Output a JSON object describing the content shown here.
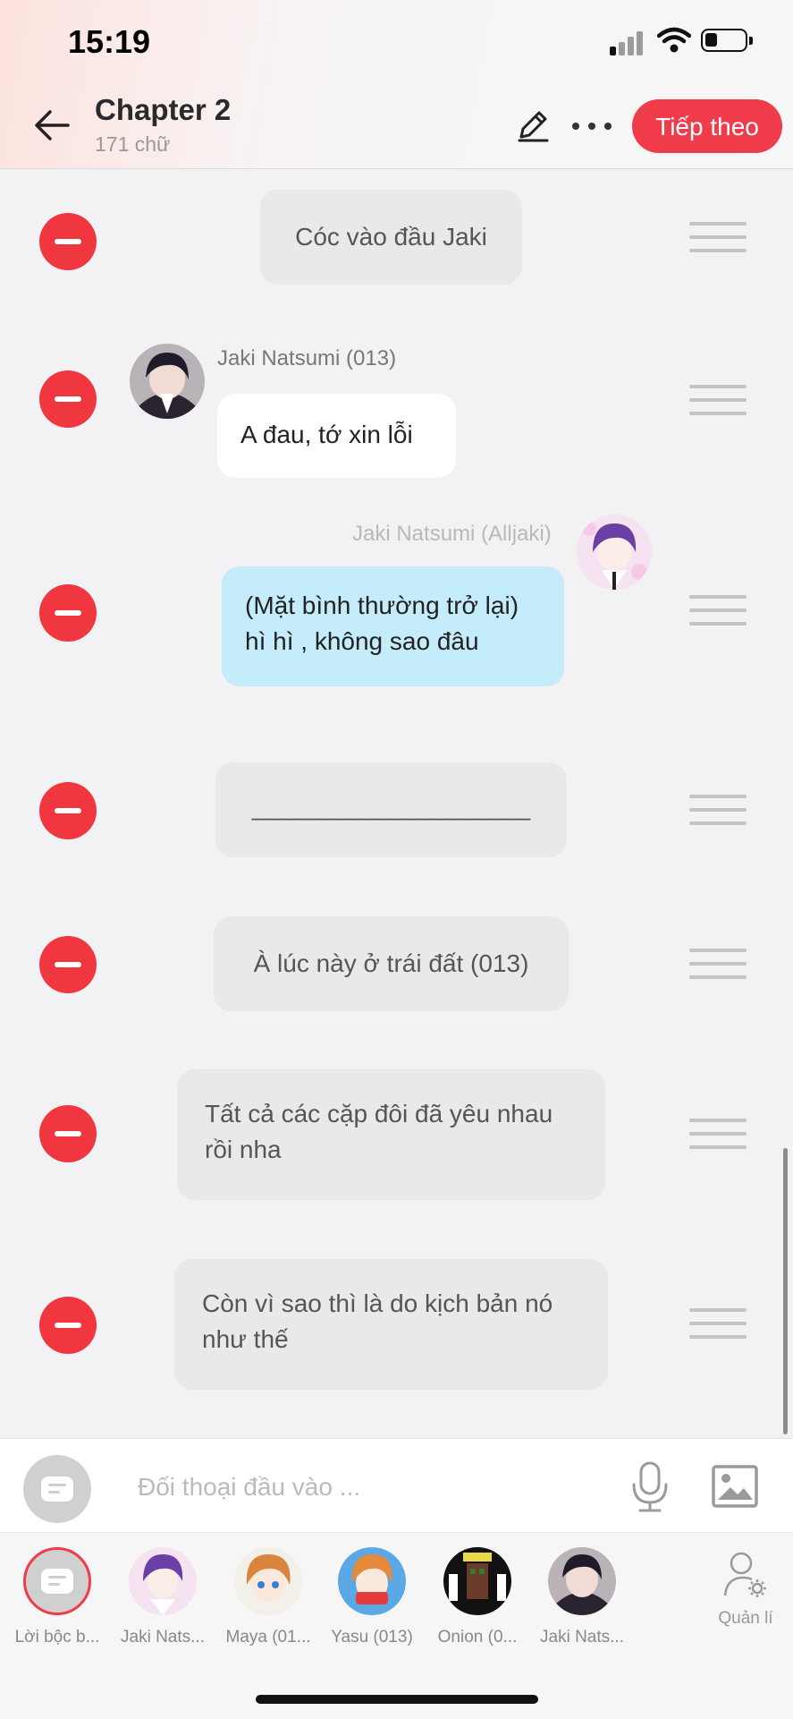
{
  "status_bar": {
    "time": "15:19"
  },
  "header": {
    "title": "Chapter 2",
    "subtitle": "171 chữ",
    "next_label": "Tiếp theo"
  },
  "messages": [
    {
      "type": "narration",
      "text": "Cóc vào đầu Jaki"
    },
    {
      "type": "left",
      "speaker": "Jaki Natsumi (013)",
      "text": "A đau, tớ xin lỗi"
    },
    {
      "type": "right",
      "speaker": "Jaki Natsumi (Alljaki)",
      "line1": "(Mặt bình thường trở lại)",
      "line2": "hì hì , không sao đâu"
    },
    {
      "type": "narration",
      "text": "____________________"
    },
    {
      "type": "narration",
      "text": "À lúc này ở trái đất (013)"
    },
    {
      "type": "narration",
      "line1": "Tất cả các cặp đôi đã yêu nhau",
      "line2": "rồi nha"
    },
    {
      "type": "narration",
      "line1": "Còn vì sao thì là do kịch bản nó",
      "line2": "như thế"
    }
  ],
  "input": {
    "placeholder": "Đối thoại đầu vào ..."
  },
  "characters": [
    {
      "label": "Lời bộc b..."
    },
    {
      "label": "Jaki Nats..."
    },
    {
      "label": "Maya (01..."
    },
    {
      "label": "Yasu (013)"
    },
    {
      "label": "Onion (0..."
    },
    {
      "label": "Jaki Nats..."
    }
  ],
  "manage_label": "Quản lí",
  "icons": [
    "back-arrow-icon",
    "pencil-icon",
    "more-icon",
    "minus-icon",
    "drag-handle-icon",
    "microphone-icon",
    "image-icon",
    "chat-icon",
    "manage-user-icon"
  ],
  "colors": {
    "accent": "#ef3b4a",
    "bubble_blue": "#c5ecfb",
    "narration_bg": "#e9e9ec"
  }
}
